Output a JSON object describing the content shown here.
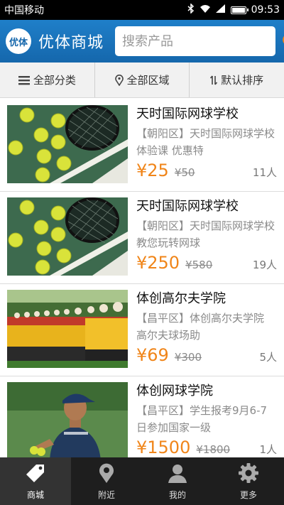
{
  "status_bar": {
    "carrier": "中国移动",
    "time": "09:53"
  },
  "header": {
    "logo_text": "优体",
    "title": "优体商城"
  },
  "search": {
    "placeholder": "搜索产品"
  },
  "filters": [
    {
      "label": "全部分类",
      "icon": "list-icon"
    },
    {
      "label": "全部区域",
      "icon": "location-pin-icon"
    },
    {
      "label": "默认排序",
      "icon": "sort-icon"
    }
  ],
  "items": [
    {
      "name": "天时国际网球学校",
      "desc": "【朝阳区】天时国际网球学校体验课 优惠特",
      "price": "¥25",
      "orig_price": "¥50",
      "people": "11人",
      "image": "tennis-balls-racket"
    },
    {
      "name": "天时国际网球学校",
      "desc": "【朝阳区】天时国际网球学校教您玩转网球",
      "price": "¥250",
      "orig_price": "¥580",
      "people": "19人",
      "image": "tennis-balls-racket"
    },
    {
      "name": "体创高尔夫学院",
      "desc": "【昌平区】体创高尔夫学院 高尔夫球场助",
      "price": "¥69",
      "orig_price": "¥300",
      "people": "5人",
      "image": "golf-caddies-lineup"
    },
    {
      "name": "体创网球学院",
      "desc": "【昌平区】学生报考9月6-7日参加国家一级",
      "price": "¥1500",
      "orig_price": "¥1800",
      "people": "1人",
      "image": "tennis-player"
    }
  ],
  "tabs": [
    {
      "label": "商城",
      "icon": "tag-icon",
      "active": true
    },
    {
      "label": "附近",
      "icon": "map-pin-icon",
      "active": false
    },
    {
      "label": "我的",
      "icon": "person-icon",
      "active": false
    },
    {
      "label": "更多",
      "icon": "gear-icon",
      "active": false
    }
  ],
  "colors": {
    "header_blue": "#1567ac",
    "price_orange": "#f08519",
    "tabbar": "#1e1e1e"
  }
}
